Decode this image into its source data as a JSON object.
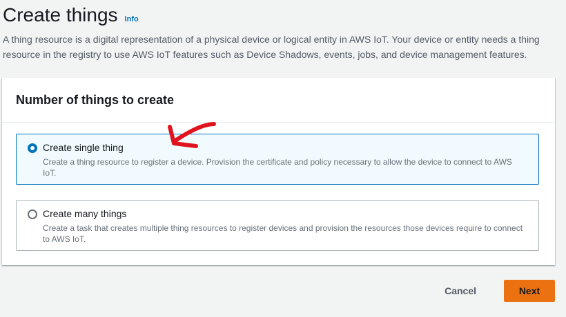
{
  "header": {
    "title": "Create things",
    "info_label": "Info",
    "description": "A thing resource is a digital representation of a physical device or logical entity in AWS IoT. Your device or entity needs a thing resource in the registry to use AWS IoT features such as Device Shadows, events, jobs, and device management features."
  },
  "panel": {
    "title": "Number of things to create",
    "options": [
      {
        "label": "Create single thing",
        "description": "Create a thing resource to register a device. Provision the certificate and policy necessary to allow the device to connect to AWS IoT.",
        "selected": true
      },
      {
        "label": "Create many things",
        "description": "Create a task that creates multiple thing resources to register devices and provision the resources those devices require to connect to AWS IoT.",
        "selected": false
      }
    ]
  },
  "footer": {
    "cancel_label": "Cancel",
    "next_label": "Next"
  },
  "colors": {
    "accent": "#0073bb",
    "primary_button": "#ec7211",
    "annotation_arrow": "#e0141e"
  }
}
